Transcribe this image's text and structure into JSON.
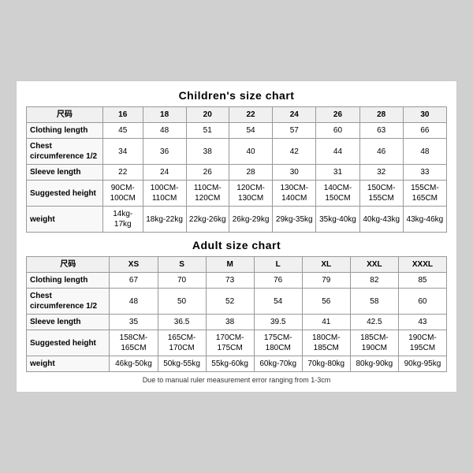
{
  "children_title": "Children's size chart",
  "adult_title": "Adult size chart",
  "note": "Due to manual ruler measurement error ranging from 1-3cm",
  "children": {
    "headers": [
      "尺码",
      "16",
      "18",
      "20",
      "22",
      "24",
      "26",
      "28",
      "30"
    ],
    "rows": [
      {
        "label": "Clothing length",
        "values": [
          "45",
          "48",
          "51",
          "54",
          "57",
          "60",
          "63",
          "66"
        ]
      },
      {
        "label": "Chest circumference 1/2",
        "values": [
          "34",
          "36",
          "38",
          "40",
          "42",
          "44",
          "46",
          "48"
        ]
      },
      {
        "label": "Sleeve length",
        "values": [
          "22",
          "24",
          "26",
          "28",
          "30",
          "31",
          "32",
          "33"
        ]
      },
      {
        "label": "Suggested height",
        "values": [
          "90CM-100CM",
          "100CM-110CM",
          "110CM-120CM",
          "120CM-130CM",
          "130CM-140CM",
          "140CM-150CM",
          "150CM-155CM",
          "155CM-165CM"
        ]
      },
      {
        "label": "weight",
        "values": [
          "14kg-17kg",
          "18kg-22kg",
          "22kg-26kg",
          "26kg-29kg",
          "29kg-35kg",
          "35kg-40kg",
          "40kg-43kg",
          "43kg-46kg"
        ]
      }
    ]
  },
  "adult": {
    "headers": [
      "尺码",
      "XS",
      "S",
      "M",
      "L",
      "XL",
      "XXL",
      "XXXL"
    ],
    "rows": [
      {
        "label": "Clothing length",
        "values": [
          "67",
          "70",
          "73",
          "76",
          "79",
          "82",
          "85"
        ]
      },
      {
        "label": "Chest circumference 1/2",
        "values": [
          "48",
          "50",
          "52",
          "54",
          "56",
          "58",
          "60"
        ]
      },
      {
        "label": "Sleeve length",
        "values": [
          "35",
          "36.5",
          "38",
          "39.5",
          "41",
          "42.5",
          "43"
        ]
      },
      {
        "label": "Suggested height",
        "values": [
          "158CM-165CM",
          "165CM-170CM",
          "170CM-175CM",
          "175CM-180CM",
          "180CM-185CM",
          "185CM-190CM",
          "190CM-195CM"
        ]
      },
      {
        "label": "weight",
        "values": [
          "46kg-50kg",
          "50kg-55kg",
          "55kg-60kg",
          "60kg-70kg",
          "70kg-80kg",
          "80kg-90kg",
          "90kg-95kg"
        ]
      }
    ]
  }
}
